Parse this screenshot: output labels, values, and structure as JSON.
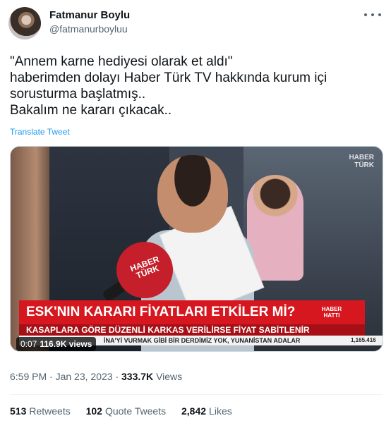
{
  "author": {
    "display_name": "Fatmanur Boylu",
    "handle": "@fatmanurboyluu"
  },
  "tweet": {
    "lines": [
      "\"Annem karne hediyesi olarak et aldı\"",
      "haberimden dolayı Haber Türk TV hakkında kurum içi",
      "sorusturma başlatmış..",
      "Bakalım ne kararı çıkacak.."
    ],
    "translate_label": "Translate Tweet"
  },
  "media": {
    "headline": "ESK'NIN KARARI FİYATLARI ETKİLER Mİ?",
    "headline_tag": "HABER HATTI",
    "subheadline": "KASAPLARA GÖRE DÜZENLİ KARKAS VERİLİRSE FİYAT SABİTLENİR",
    "ticker": "İNA'Yİ VURMAK GİBİ BİR DERDİMİZ YOK, YUNANİSTAN ADALAR",
    "ticker_number": "1,165.416",
    "mic_label": "HABER TÜRK",
    "corner_logo": "HABER TÜRK",
    "duration": "0:07",
    "views": "116.9K views"
  },
  "meta": {
    "time": "6:59 PM",
    "separator": "·",
    "date": "Jan 23, 2023",
    "views_count": "333.7K",
    "views_label": "Views"
  },
  "stats": {
    "retweets_count": "513",
    "retweets_label": "Retweets",
    "quotes_count": "102",
    "quotes_label": "Quote Tweets",
    "likes_count": "2,842",
    "likes_label": "Likes"
  },
  "colors": {
    "link": "#1d9bf0",
    "secondary_text": "#536471",
    "headline_red": "#d7171f"
  }
}
